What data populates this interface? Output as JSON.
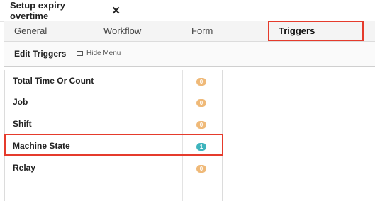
{
  "doc_tab": {
    "title": "Setup expiry overtime",
    "close_glyph": "✕"
  },
  "sections": [
    {
      "label": "General",
      "active": false
    },
    {
      "label": "Workflow",
      "active": false
    },
    {
      "label": "Form",
      "active": false
    },
    {
      "label": "Triggers",
      "active": true
    }
  ],
  "toolbar": {
    "title": "Edit Triggers",
    "hide_menu_label": "Hide Menu"
  },
  "triggers": [
    {
      "label": "Total Time Or Count",
      "count": "0"
    },
    {
      "label": "Job",
      "count": "0"
    },
    {
      "label": "Shift",
      "count": "0"
    },
    {
      "label": "Machine State",
      "count": "1"
    },
    {
      "label": "Relay",
      "count": "0"
    }
  ],
  "colors": {
    "highlight_outline": "#e53b2c",
    "badge_zero": "#efb978",
    "badge_nonzero": "#3eb4bd"
  }
}
